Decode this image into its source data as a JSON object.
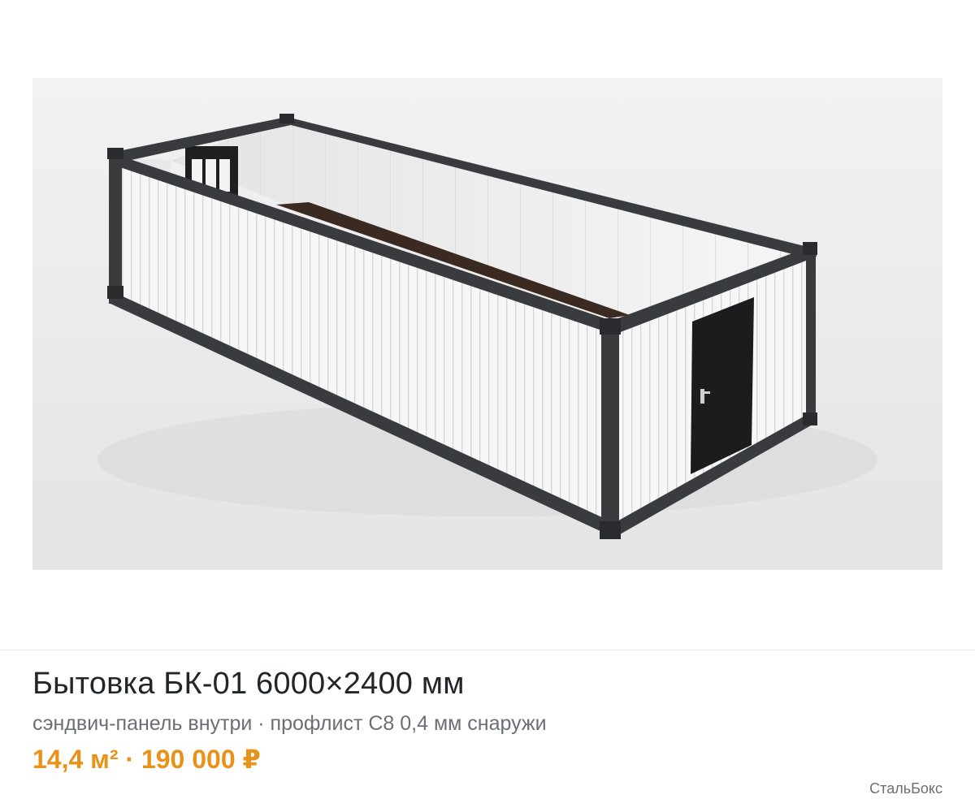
{
  "product": {
    "title": "Бытовка БК-01 6000×2400 мм",
    "subtitle": "сэндвич-панель внутри · профлист С8 0,4 мм снаружи",
    "area": "14,4 м²",
    "separator": " · ",
    "price": "190 000 ₽",
    "brand": "СтальБокс"
  },
  "colors": {
    "accent": "#e8921a",
    "title": "#222529",
    "muted": "#6b6f75",
    "frame": "#3a3b3e",
    "panel": "#f4f4f4",
    "floor": "#3b2a22",
    "door": "#1c1c1e",
    "image_background": "#ececec"
  }
}
